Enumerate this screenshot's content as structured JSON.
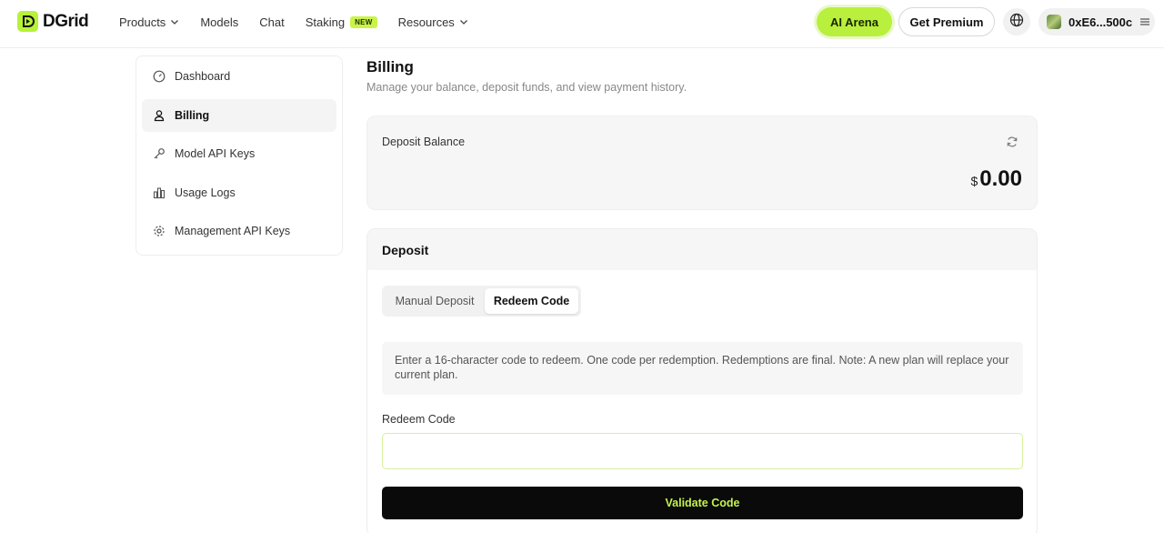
{
  "brand": {
    "name": "DGrid",
    "accent": "#b9ef3d"
  },
  "nav": {
    "items": [
      {
        "label": "Products",
        "has_dropdown": true
      },
      {
        "label": "Models"
      },
      {
        "label": "Chat"
      },
      {
        "label": "Staking",
        "badge": "NEW"
      },
      {
        "label": "Resources",
        "has_dropdown": true
      }
    ]
  },
  "header": {
    "ai_arena_label": "AI Arena",
    "premium_label": "Get Premium",
    "language_icon": "globe-icon",
    "wallet_address": "0xE6...500c"
  },
  "sidebar": {
    "items": [
      {
        "label": "Dashboard",
        "icon": "gauge-icon",
        "active": false
      },
      {
        "label": "Billing",
        "icon": "user-icon",
        "active": true
      },
      {
        "label": "Model API Keys",
        "icon": "key-icon",
        "active": false
      },
      {
        "label": "Usage Logs",
        "icon": "bar-chart-icon",
        "active": false
      },
      {
        "label": "Management API Keys",
        "icon": "gear-icon",
        "active": false
      }
    ]
  },
  "main": {
    "title": "Billing",
    "subtitle": "Manage your balance, deposit funds, and view payment history.",
    "balance": {
      "label": "Deposit Balance",
      "currency": "$",
      "amount": "0.00"
    },
    "deposit": {
      "title": "Deposit",
      "tabs": [
        {
          "label": "Manual Deposit",
          "active": false
        },
        {
          "label": "Redeem Code",
          "active": true
        }
      ],
      "notice": "Enter a 16-character code to redeem. One code per redemption. Redemptions are final. Note: A new plan will replace your current plan.",
      "field_label": "Redeem Code",
      "input_value": "",
      "input_placeholder": "",
      "submit_label": "Validate Code"
    }
  }
}
